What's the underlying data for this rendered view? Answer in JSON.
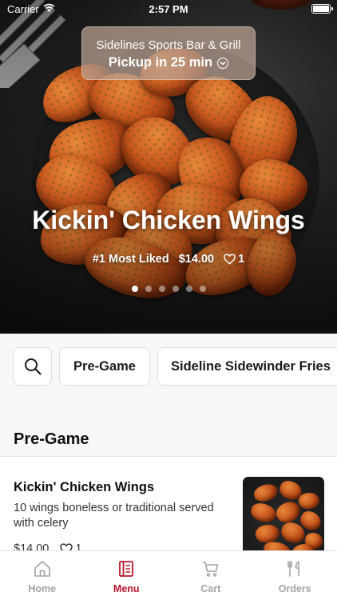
{
  "status_bar": {
    "carrier": "Carrier",
    "time": "2:57 PM"
  },
  "restaurant": {
    "name": "Sidelines Sports Bar & Grill",
    "pickup": "Pickup in 25 min"
  },
  "featured": {
    "title": "Kickin' Chicken Wings",
    "badge": "#1 Most Liked",
    "price": "$14.00",
    "likes": "1",
    "carousel_pages": 6,
    "carousel_active": 1
  },
  "categories": {
    "search_icon": "search-icon",
    "chips": [
      "Pre-Game",
      "Sideline Sidewinder Fries"
    ]
  },
  "section": {
    "title": "Pre-Game",
    "items": [
      {
        "name": "Kickin' Chicken Wings",
        "description": "10 wings boneless or traditional served with celery",
        "price": "$14.00",
        "likes": "1"
      }
    ]
  },
  "tabbar": {
    "accent_color": "#b7162a",
    "inactive_color": "#a3a3a3",
    "tabs": [
      {
        "label": "Home",
        "icon": "home-icon"
      },
      {
        "label": "Menu",
        "icon": "menu-icon",
        "active": true
      },
      {
        "label": "Cart",
        "icon": "cart-icon"
      },
      {
        "label": "Orders",
        "icon": "orders-icon"
      }
    ]
  }
}
